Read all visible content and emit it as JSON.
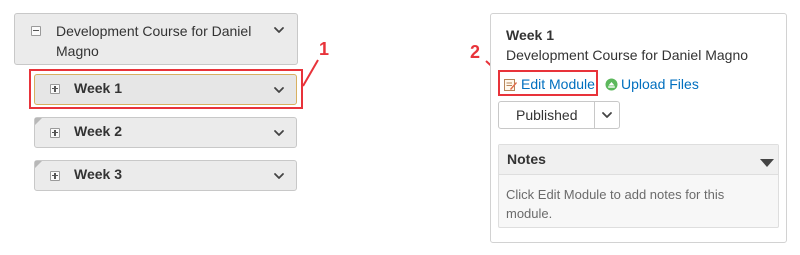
{
  "tree": {
    "course_title": "Development Course for Daniel Magno",
    "modules": [
      {
        "label": "Week 1"
      },
      {
        "label": "Week 2"
      },
      {
        "label": "Week 3"
      }
    ]
  },
  "annotations": {
    "callout_1": "1",
    "callout_2": "2"
  },
  "panel": {
    "title": "Week 1",
    "subtitle": "Development Course for Daniel Magno",
    "edit_module_label": "Edit Module",
    "upload_files_label": "Upload Files",
    "status_value": "Published",
    "notes_title": "Notes",
    "notes_text": "Click Edit Module to add notes for this module."
  },
  "colors": {
    "link": "#006fbf",
    "annotation": "#e8333a",
    "upload_icon": "#5cb85c"
  }
}
